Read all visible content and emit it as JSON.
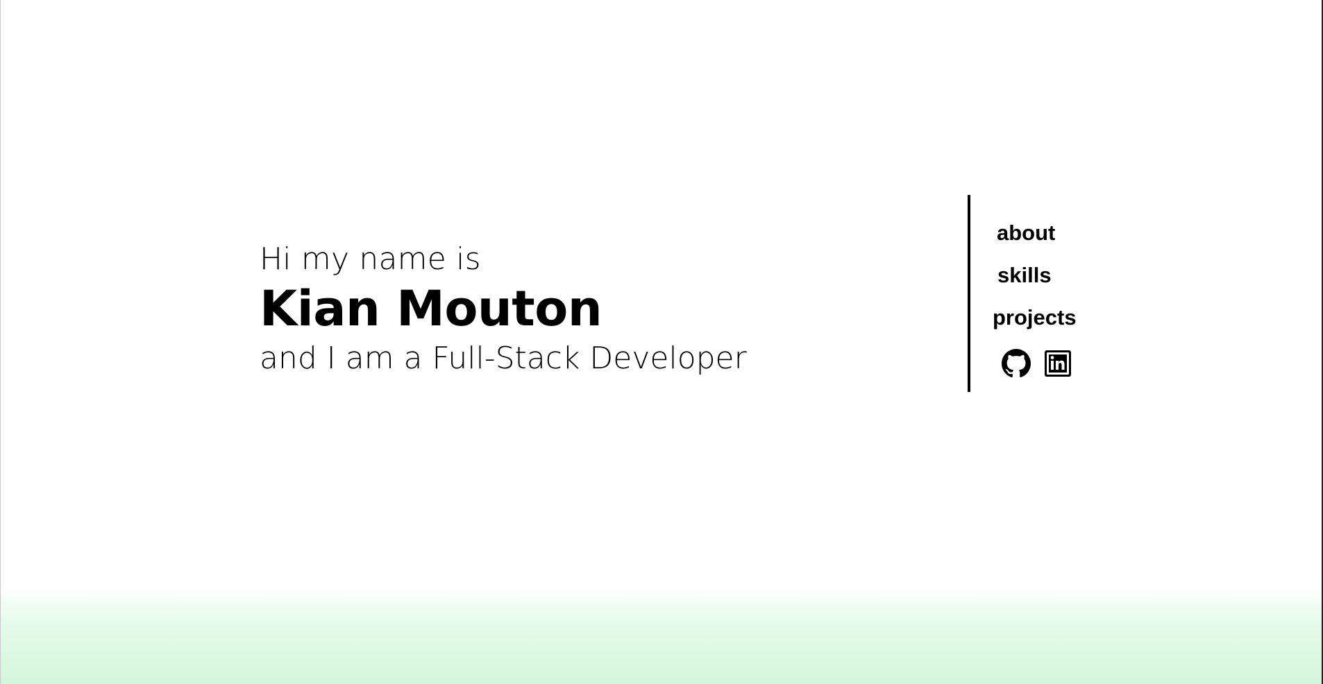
{
  "hero": {
    "greeting": "Hi my name is",
    "name": "Kian Mouton",
    "role_prefix": "and I am a ",
    "role": "Full-Stack Developer"
  },
  "nav": {
    "items": [
      {
        "label": "about"
      },
      {
        "label": "skills"
      },
      {
        "label": "projects"
      }
    ]
  },
  "socials": [
    {
      "icon": "github-icon"
    },
    {
      "icon": "linkedin-icon"
    }
  ],
  "colors": {
    "text": "#000000",
    "background": "#ffffff",
    "bottom_gradient": "#d3f6db"
  }
}
